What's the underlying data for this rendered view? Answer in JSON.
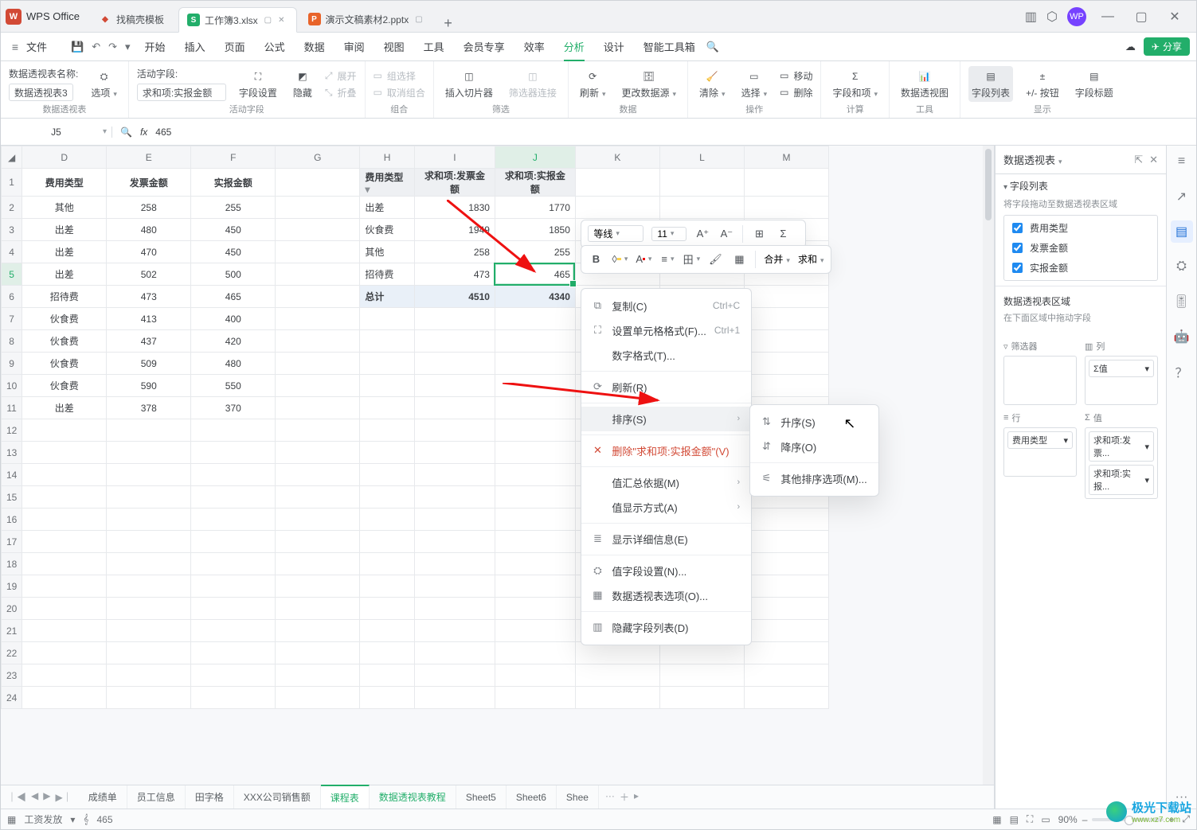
{
  "app": {
    "name": "WPS Office"
  },
  "doc_tabs": [
    {
      "icon": "doc",
      "label": "找稿壳模板"
    },
    {
      "icon": "xls",
      "label": "工作簿3.xlsx",
      "active": true
    },
    {
      "icon": "ppt",
      "label": "演示文稿素材2.pptx"
    }
  ],
  "menu": {
    "file": "文件",
    "items": [
      "开始",
      "插入",
      "页面",
      "公式",
      "数据",
      "审阅",
      "视图",
      "工具",
      "会员专享",
      "效率",
      "分析",
      "设计",
      "智能工具箱"
    ],
    "active": "分析",
    "share": "分享"
  },
  "ribbon": {
    "grp1": {
      "label": "数据透视表",
      "name": "数据透视表名称:",
      "value": "数据透视表3",
      "options": "选项"
    },
    "grp2": {
      "label": "活动字段",
      "name": "活动字段:",
      "value": "求和项:实报金额",
      "fs": "字段设置",
      "hide": "隐藏",
      "expand": "展开",
      "collapse": "折叠"
    },
    "grp3": {
      "label": "组合",
      "gs": "组选择",
      "ug": "取消组合"
    },
    "grp4": {
      "label": "筛选",
      "slicer": "插入切片器",
      "fc": "筛选器连接"
    },
    "grp5": {
      "label": "数据",
      "refresh": "刷新",
      "chsrc": "更改数据源"
    },
    "grp6": {
      "label": "操作",
      "clear": "清除",
      "select": "选择",
      "move": "移动",
      "delete": "删除"
    },
    "grp7": {
      "label": "计算",
      "fi": "字段和项"
    },
    "grp8": {
      "label": "工具",
      "pc": "数据透视图"
    },
    "grp9": {
      "label": "显示",
      "fl": "字段列表",
      "pm": "+/- 按钮",
      "fh": "字段标题"
    }
  },
  "namebox": "J5",
  "formula": "465",
  "columns_left": [
    "D",
    "E",
    "F",
    "G"
  ],
  "columns_pv": [
    "H",
    "I",
    "J"
  ],
  "columns_tail": [
    "K",
    "L",
    "M"
  ],
  "left_table": {
    "headers": [
      "费用类型",
      "发票金额",
      "实报金额"
    ],
    "rows": [
      [
        "其他",
        "258",
        "255"
      ],
      [
        "出差",
        "480",
        "450"
      ],
      [
        "出差",
        "470",
        "450"
      ],
      [
        "出差",
        "502",
        "500"
      ],
      [
        "招待费",
        "473",
        "465"
      ],
      [
        "伙食费",
        "413",
        "400"
      ],
      [
        "伙食费",
        "437",
        "420"
      ],
      [
        "伙食费",
        "509",
        "480"
      ],
      [
        "伙食费",
        "590",
        "550"
      ],
      [
        "出差",
        "378",
        "370"
      ]
    ]
  },
  "pivot": {
    "headers": [
      "费用类型",
      "求和项:发票金额",
      "求和项:实报金额"
    ],
    "rows": [
      [
        "出差",
        "1830",
        "1770"
      ],
      [
        "伙食费",
        "1949",
        "1850"
      ],
      [
        "其他",
        "258",
        "255"
      ],
      [
        "招待费",
        "473",
        "465"
      ]
    ],
    "total_label": "总计",
    "totals": [
      "4510",
      "4340"
    ]
  },
  "sel_cell": {
    "value": "465"
  },
  "mini_toolbar": {
    "font": "等线",
    "size": "11",
    "merge": "合并",
    "sum": "求和"
  },
  "context_menu": {
    "copy": "复制(C)",
    "copy_sc": "Ctrl+C",
    "format": "设置单元格格式(F)...",
    "format_sc": "Ctrl+1",
    "num": "数字格式(T)...",
    "refresh": "刷新(R)",
    "sort": "排序(S)",
    "del": "删除\"求和项:实报金额\"(V)",
    "summ": "值汇总依据(M)",
    "show": "值显示方式(A)",
    "detail": "显示详细信息(E)",
    "vfs": "值字段设置(N)...",
    "opts": "数据透视表选项(O)...",
    "hidefl": "隐藏字段列表(D)"
  },
  "sort_submenu": {
    "asc": "升序(S)",
    "desc": "降序(O)",
    "more": "其他排序选项(M)..."
  },
  "panel": {
    "title": "数据透视表",
    "sec1": "字段列表",
    "hint1": "将字段拖动至数据透视表区域",
    "fields": [
      "费用类型",
      "发票金额",
      "实报金额"
    ],
    "area_title": "数据透视表区域",
    "hint2": "在下面区域中拖动字段",
    "filter": "筛选器",
    "col": "列",
    "row": "行",
    "val": "值",
    "col_chip": "Σ值",
    "row_chip": "费用类型",
    "val_chip1": "求和项:发票...",
    "val_chip2": "求和项:实报..."
  },
  "sheet_tabs": {
    "items": [
      "成绩单",
      "员工信息",
      "田字格",
      "XXX公司销售额",
      "课程表",
      "数据透视表教程",
      "Sheet5",
      "Sheet6",
      "Shee"
    ],
    "active": "课程表",
    "alt_green": "数据透视表教程"
  },
  "status": {
    "left1": "工资发放",
    "left2": "465",
    "zoom": "90%"
  },
  "watermark": {
    "t1": "极光下载站",
    "t2": "www.xz7.com"
  }
}
